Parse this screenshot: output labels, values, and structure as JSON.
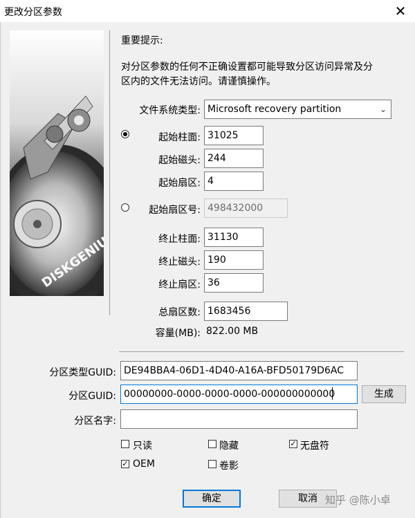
{
  "window": {
    "title": "更改分区参数",
    "close_glyph": "✕"
  },
  "notice": {
    "heading": "重要提示:",
    "line1": "对分区参数的任何不正确设置都可能导致分区访问异常及分",
    "line2": "区内的文件无法访问。请谨慎操作。"
  },
  "fs_type": {
    "label": "文件系统类型:",
    "value": "Microsoft recovery partition"
  },
  "chs_start": {
    "cylinder_label": "起始柱面:",
    "cylinder": "31025",
    "head_label": "起始磁头:",
    "head": "244",
    "sector_label": "起始扇区:",
    "sector": "4"
  },
  "lba_start": {
    "label": "起始扇区号:",
    "value": "498432000"
  },
  "chs_end": {
    "cylinder_label": "终止柱面:",
    "cylinder": "31130",
    "head_label": "终止磁头:",
    "head": "190",
    "sector_label": "终止扇区:",
    "sector": "36"
  },
  "total_sectors": {
    "label": "总扇区数:",
    "value": "1683456"
  },
  "capacity": {
    "label": "容量(MB):",
    "value": "822.00 MB"
  },
  "type_guid": {
    "label": "分区类型GUID:",
    "value": "DE94BBA4-06D1-4D40-A16A-BFD50179D6AC"
  },
  "part_guid": {
    "label": "分区GUID:",
    "value": "00000000-0000-0000-0000-000000000000",
    "generate_label": "生成"
  },
  "part_name": {
    "label": "分区名字:",
    "value": ""
  },
  "checkboxes": {
    "readonly": "只读",
    "hidden": "隐藏",
    "no_letter": "无盘符",
    "oem": "OEM",
    "shadow": "卷影"
  },
  "buttons": {
    "ok": "确定",
    "cancel": "取消"
  },
  "watermark": "知乎 @陈小卓",
  "art_text": "DISKGENIUS"
}
